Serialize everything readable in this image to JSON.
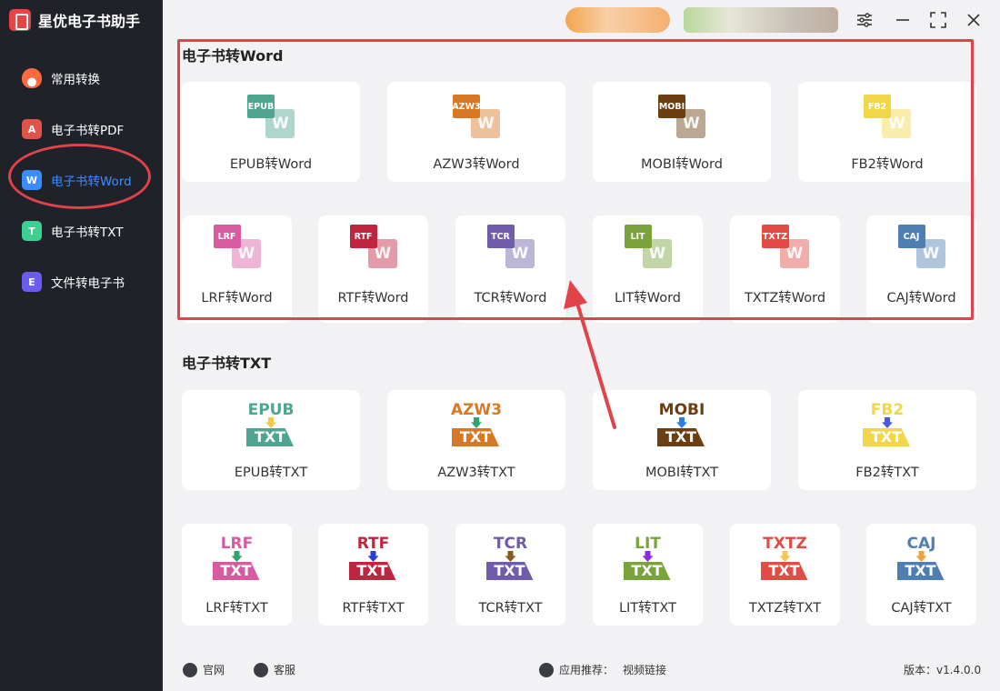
{
  "app": {
    "title": "星优电子书助手"
  },
  "sidebar": {
    "items": [
      {
        "label": "常用转换",
        "icon": "flame-icon",
        "color": "#e8453c",
        "glyph": ""
      },
      {
        "label": "电子书转PDF",
        "icon": "pdf-icon",
        "color": "#e0534a",
        "glyph": "A"
      },
      {
        "label": "电子书转Word",
        "icon": "word-icon",
        "color": "#3b8cff",
        "glyph": "W"
      },
      {
        "label": "电子书转TXT",
        "icon": "txt-icon",
        "color": "#3ccf8e",
        "glyph": "T"
      },
      {
        "label": "文件转电子书",
        "icon": "ebook-icon",
        "color": "#6b5cf0",
        "glyph": "E"
      }
    ]
  },
  "sections": {
    "word": {
      "title": "电子书转Word",
      "cards": [
        {
          "fmt": "EPUB",
          "label": "EPUB转Word",
          "color": "#4fa58f"
        },
        {
          "fmt": "AZW3",
          "label": "AZW3转Word",
          "color": "#d77825"
        },
        {
          "fmt": "MOBI",
          "label": "MOBI转Word",
          "color": "#6b3f12"
        },
        {
          "fmt": "FB2",
          "label": "FB2转Word",
          "color": "#f2d64a"
        },
        {
          "fmt": "LRF",
          "label": "LRF转Word",
          "color": "#d85aa0"
        },
        {
          "fmt": "RTF",
          "label": "RTF转Word",
          "color": "#c0243f"
        },
        {
          "fmt": "TCR",
          "label": "TCR转Word",
          "color": "#6f5cab"
        },
        {
          "fmt": "LIT",
          "label": "LIT转Word",
          "color": "#7aa33c"
        },
        {
          "fmt": "TXTZ",
          "label": "TXTZ转Word",
          "color": "#e24c44"
        },
        {
          "fmt": "CAJ",
          "label": "CAJ转Word",
          "color": "#4f7fb2"
        }
      ]
    },
    "txt": {
      "title": "电子书转TXT",
      "box_label": "TXT",
      "cards": [
        {
          "fmt": "EPUB",
          "label": "EPUB转TXT",
          "color": "#4fa58f",
          "arrow": "#f2c94c"
        },
        {
          "fmt": "AZW3",
          "label": "AZW3转TXT",
          "color": "#d77825",
          "arrow": "#2aa56b"
        },
        {
          "fmt": "MOBI",
          "label": "MOBI转TXT",
          "color": "#6b3f12",
          "arrow": "#2f7de1"
        },
        {
          "fmt": "FB2",
          "label": "FB2转TXT",
          "color": "#f2d64a",
          "arrow": "#4a56e0"
        },
        {
          "fmt": "LRF",
          "label": "LRF转TXT",
          "color": "#d85aa0",
          "arrow": "#2aa56b"
        },
        {
          "fmt": "RTF",
          "label": "RTF转TXT",
          "color": "#c0243f",
          "arrow": "#2a3fd0"
        },
        {
          "fmt": "TCR",
          "label": "TCR转TXT",
          "color": "#6f5cab",
          "arrow": "#8a5a1c"
        },
        {
          "fmt": "LIT",
          "label": "LIT转TXT",
          "color": "#7aa33c",
          "arrow": "#8a2be2"
        },
        {
          "fmt": "TXTZ",
          "label": "TXTZ转TXT",
          "color": "#e24c44",
          "arrow": "#f2c94c"
        },
        {
          "fmt": "CAJ",
          "label": "CAJ转TXT",
          "color": "#4f7fb2",
          "arrow": "#f2a23c"
        }
      ]
    }
  },
  "footer": {
    "website": "官网",
    "service": "客服",
    "recommend_label": "应用推荐：",
    "recommend_link": "视频链接",
    "version": "版本：v1.4.0.0"
  },
  "colors": {
    "accent": "#3b8cff",
    "highlight": "#e2434a",
    "sidebar_bg": "#1f2229"
  }
}
